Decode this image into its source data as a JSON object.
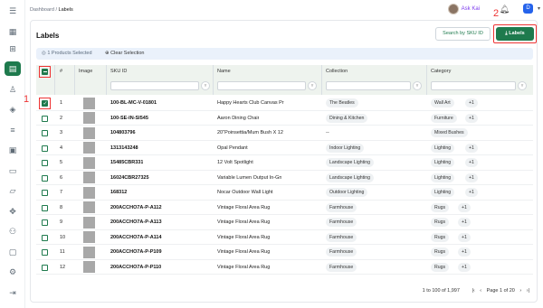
{
  "breadcrumb": {
    "root": "Dashboard",
    "sep": "/",
    "current": "Labels"
  },
  "user": {
    "name": "Ask Kai",
    "account_initial": "D"
  },
  "page": {
    "title": "Labels",
    "search_sku_button": "Search by SKU ID",
    "labels_button": "Labels",
    "selected_text": "1 Products Selected",
    "clear_text": "Clear Selection"
  },
  "annotations": {
    "one": "1",
    "two": "2"
  },
  "table": {
    "columns": {
      "num": "#",
      "image": "Image",
      "sku": "SKU ID",
      "name": "Name",
      "collection": "Collection",
      "category": "Category"
    },
    "rows": [
      {
        "n": "1",
        "sku": "100-BL-MC-V-01801",
        "name": "Happy Hearts Club Canvas Pr",
        "collection": "The Beatles",
        "category": "Wall Art",
        "more": "+1",
        "checked": true
      },
      {
        "n": "2",
        "sku": "100-SE-IN-SI545",
        "name": "Aaron Dining Chair",
        "collection": "Dining & Kitchen",
        "category": "Furniture",
        "more": "+1",
        "checked": false
      },
      {
        "n": "3",
        "sku": "104803796",
        "name": "20\"Poinsettia/Mum Bush X 12",
        "collection": "--",
        "category": "Mixed Bushes",
        "more": "",
        "checked": false
      },
      {
        "n": "4",
        "sku": "1313143248",
        "name": "Opal Pendant",
        "collection": "Indoor Lighting",
        "category": "Lighting",
        "more": "+1",
        "checked": false
      },
      {
        "n": "5",
        "sku": "15485CBR331",
        "name": "12 Volt Spotlight",
        "collection": "Landscape Lighting",
        "category": "Lighting",
        "more": "+1",
        "checked": false
      },
      {
        "n": "6",
        "sku": "16024CBR27325",
        "name": "Variable Lumen Output In-Gn",
        "collection": "Landscape Lighting",
        "category": "Lighting",
        "more": "+1",
        "checked": false
      },
      {
        "n": "7",
        "sku": "168312",
        "name": "Nocar Outdoor Wall Light",
        "collection": "Outdoor Lighting",
        "category": "Lighting",
        "more": "+1",
        "checked": false
      },
      {
        "n": "8",
        "sku": "200ACCHO7A-P-A112",
        "name": "Vintage Floral Area Rug",
        "collection": "Farmhouse",
        "category": "Rugs",
        "more": "+1",
        "checked": false
      },
      {
        "n": "9",
        "sku": "200ACCHO7A-P-A113",
        "name": "Vintage Floral Area Rug",
        "collection": "Farmhouse",
        "category": "Rugs",
        "more": "+1",
        "checked": false
      },
      {
        "n": "10",
        "sku": "200ACCHO7A-P-A114",
        "name": "Vintage Floral Area Rug",
        "collection": "Farmhouse",
        "category": "Rugs",
        "more": "+1",
        "checked": false
      },
      {
        "n": "11",
        "sku": "200ACCHO7A-P-P109",
        "name": "Vintage Floral Area Rug",
        "collection": "Farmhouse",
        "category": "Rugs",
        "more": "+1",
        "checked": false
      },
      {
        "n": "12",
        "sku": "200ACCHO7A-P-P110",
        "name": "Vintage Floral Area Rug",
        "collection": "Farmhouse",
        "category": "Rugs",
        "more": "+1",
        "checked": false
      }
    ]
  },
  "pagination": {
    "range": "1 to 100 of 1,997",
    "page_text": "Page 1 of 20"
  },
  "colors": {
    "brand_green": "#1e7a4d",
    "annotation_red": "#e33333",
    "selection_bar": "#eaf1fb"
  }
}
